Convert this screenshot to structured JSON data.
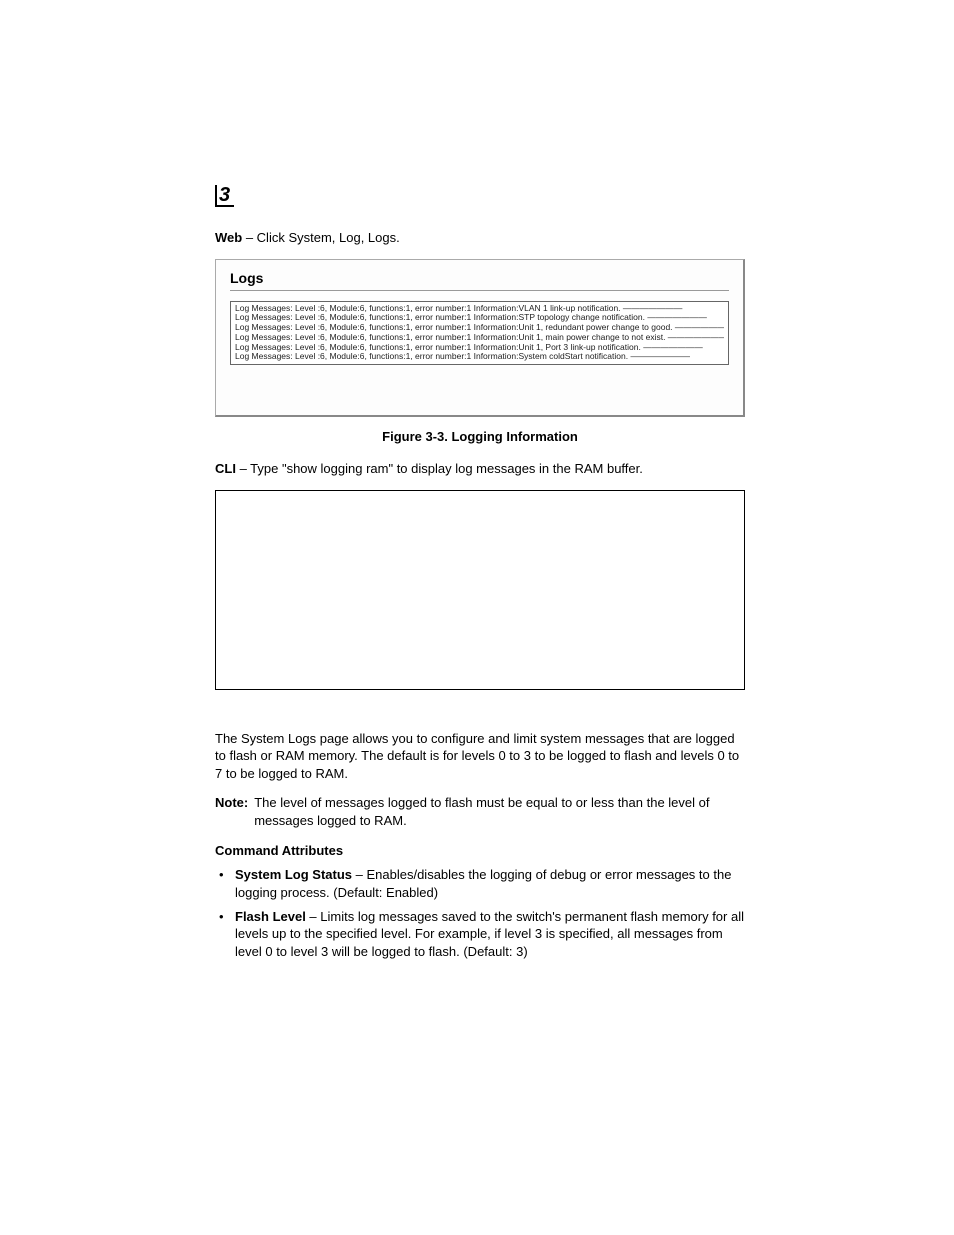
{
  "chapter_badge": "3",
  "web_line": {
    "prefix": "Web",
    "rest": " – Click System, Log, Logs."
  },
  "logs_panel": {
    "title": "Logs",
    "lines": [
      "Log Messages: Level :6, Module:6, functions:1, error number:1 Information:VLAN 1 link-up notification. ———————",
      "Log Messages: Level :6, Module:6, functions:1, error number:1 Information:STP topology change notification. ———————",
      "Log Messages: Level :6, Module:6, functions:1, error number:1 Information:Unit 1, redundant power change to good. ———————",
      "Log Messages: Level :6, Module:6, functions:1, error number:1 Information:Unit 1, main power change to not exist. ———————",
      "Log Messages: Level :6, Module:6, functions:1, error number:1 Information:Unit 1, Port 3 link-up notification. ———————",
      "Log Messages: Level :6, Module:6, functions:1, error number:1 Information:System coldStart notification. ———————"
    ]
  },
  "figure_caption": "Figure 3-3.   Logging Information",
  "cli_line": {
    "prefix": "CLI",
    "rest": " – Type \"show logging ram\"  to display log messages in the RAM buffer."
  },
  "body_para": "The System Logs page allows you to configure and limit system messages that are logged to flash or RAM memory. The default is for levels 0 to 3 to be logged to flash and levels 0 to 7 to be logged to RAM.",
  "note": {
    "label": "Note:",
    "text": "The level of messages logged to flash must be equal to or less than the level of messages logged to RAM."
  },
  "command_attributes_heading": "Command Attributes",
  "attributes": [
    {
      "name": "System Log Status",
      "desc": " – Enables/disables the logging of debug or error messages to the logging process. (Default: Enabled)"
    },
    {
      "name": "Flash Level",
      "desc": " – Limits log messages saved to the switch's permanent flash memory for all levels up to the specified level. For example, if level 3 is specified, all messages from level 0 to level 3 will be logged to flash. (Default: 3)"
    }
  ]
}
